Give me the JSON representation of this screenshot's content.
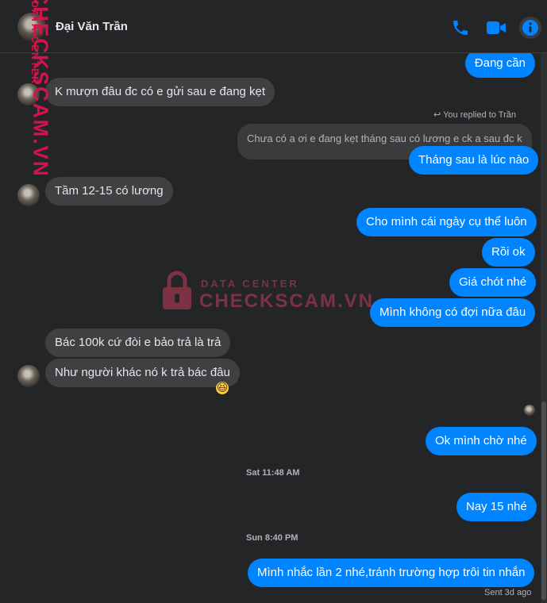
{
  "header": {
    "contact_name": "Đại Văn Trần",
    "icons": [
      "phone-icon",
      "video-camera-icon",
      "info-icon"
    ],
    "accent_color": "#0084ff"
  },
  "watermark": {
    "side_big": "CHECKSCAM.VN",
    "side_small": "DATA CENTER",
    "center_top": "DATA CENTER",
    "center_bottom": "CHECKSCAM.VN"
  },
  "messages": {
    "m1": "Đang cần",
    "m2": "K mượn đâu đc có e gửi sau e đang kẹt",
    "reply_note": "You replied to Trần",
    "reply_quote": "Chưa có a ơi e đang kẹt tháng sau có lương e ck a sau đc k",
    "m3": "Tháng sau là lúc nào",
    "m4": "Tầm 12-15 có lương",
    "m5": "Cho mình cái ngày cụ thể luôn",
    "m6": "Rồi ok",
    "m7": "Giá chót nhé",
    "m8": "Mình không có đợi nữa đâu",
    "m9": "Bác 100k cứ đòi e bảo trả là trả",
    "m10": "Như người khác nó k trả bác đâu",
    "m10_reaction": "😆",
    "m11": "Ok mình chờ nhé",
    "stamp1": "Sat 11:48 AM",
    "m12": "Nay 15 nhé",
    "stamp2": "Sun 8:40 PM",
    "m13": "Mình nhắc lần 2 nhé,tránh trường hợp trôi tin nhắn",
    "status": "Sent 3d ago"
  }
}
